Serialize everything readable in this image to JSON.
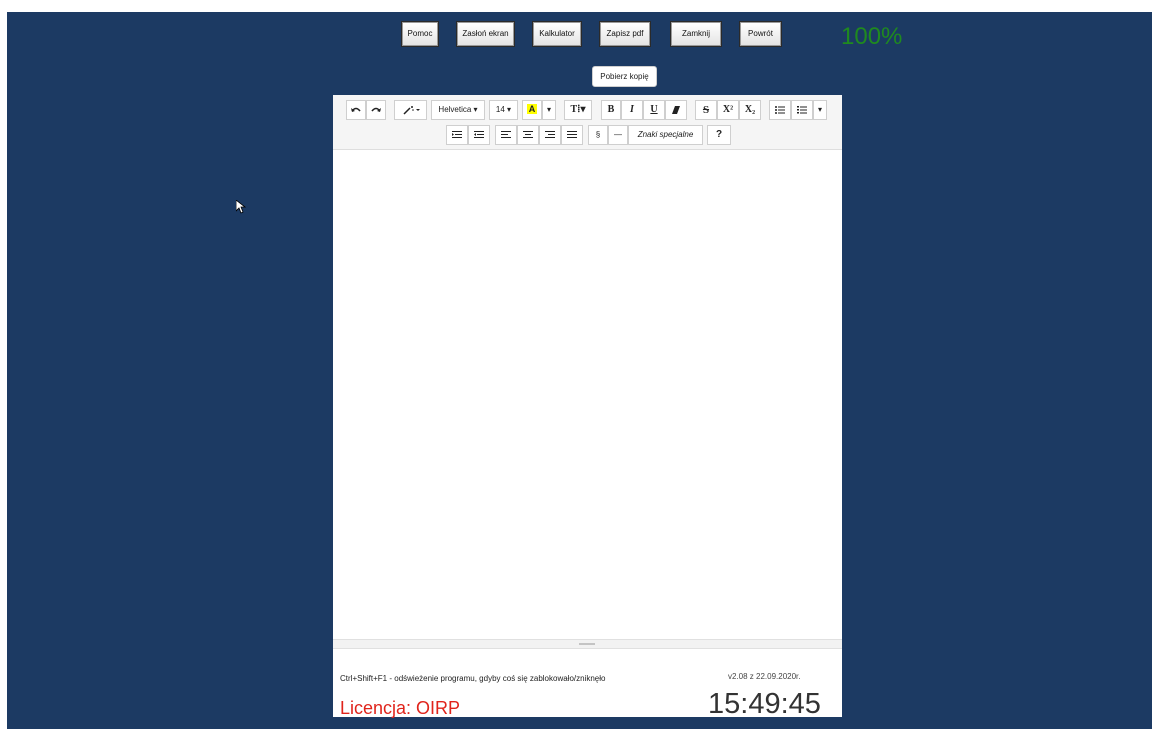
{
  "top_buttons": {
    "help": "Pomoc",
    "cover_screen": "Zasłoń ekran",
    "calculator": "Kalkulator",
    "save_pdf": "Zapisz pdf",
    "close": "Zamknij",
    "back": "Powrót"
  },
  "zoom_level": "100%",
  "download_copy": "Pobierz kopię",
  "toolbar": {
    "font_name": "Helvetica ▾",
    "font_size": "14 ▾",
    "font_color": "A",
    "dropdown_caret": "▾",
    "text_style": "T⁞▾",
    "bold": "B",
    "italic": "I",
    "underline": "U",
    "strikethrough": "S",
    "superscript": "X²",
    "subscript": "X₂",
    "section": "§",
    "dash": "—",
    "special_chars": "Znaki specjalne",
    "help": "?"
  },
  "footer": {
    "hint": "Ctrl+Shift+F1 - odświeżenie programu, gdyby coś się zablokowało/zniknęło",
    "version": "v2.08 z 22.09.2020r.",
    "licence": "Licencja: OIRP",
    "clock": "15:49:45"
  },
  "colors": {
    "background": "#1c3a63",
    "zoom": "#1f8a1f",
    "licence": "#e0241b",
    "font_highlight": "#ffff00"
  }
}
